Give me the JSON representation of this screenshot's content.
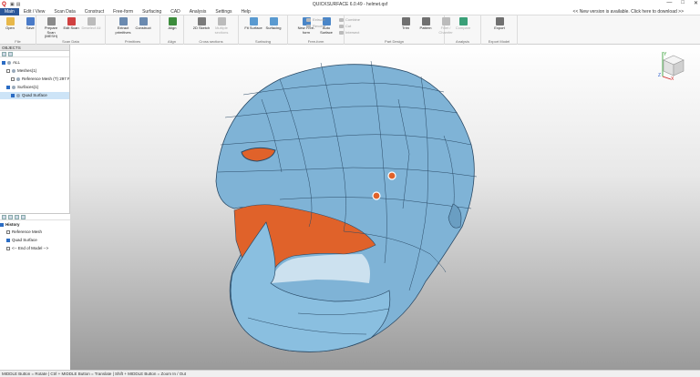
{
  "app": {
    "title": "QUICKSURFACE 6.0.49 - helmet.qsf",
    "notice": "<< New version is available. Click here to download >>",
    "window_controls": [
      "—",
      "□",
      "✕"
    ]
  },
  "menu": {
    "tabs": [
      "Main",
      "Edit / View",
      "Scan Data",
      "Construct",
      "Free-form",
      "Surfacing",
      "CAD",
      "Analysis",
      "Settings",
      "Help"
    ],
    "active_index": 0
  },
  "ribbon": {
    "groups": [
      {
        "label": "File",
        "buttons": [
          {
            "label": "Open",
            "icon": "folder-icon",
            "color": "#e8b84a"
          },
          {
            "label": "Save",
            "icon": "save-icon",
            "color": "#4a7bc8"
          }
        ]
      },
      {
        "label": "Scan Data",
        "buttons": [
          {
            "label": "Prepare Scan (MESH)",
            "icon": "mesh-icon",
            "color": "#8a8a8a"
          },
          {
            "label": "Edit Scan",
            "icon": "edit-scan-icon",
            "color": "#d04040"
          },
          {
            "label": "Deselect All",
            "icon": "deselect-icon",
            "color": "#bbbbbb",
            "dim": true
          }
        ]
      },
      {
        "label": "Primitives",
        "buttons": [
          {
            "label": "Extract primitives",
            "icon": "extract-icon",
            "color": "#6a8ab0"
          },
          {
            "label": "Construct",
            "icon": "construct-icon",
            "color": "#6a8ab0"
          }
        ]
      },
      {
        "label": "Align",
        "buttons": [
          {
            "label": "Align",
            "icon": "align-icon",
            "color": "#3c8c3c"
          }
        ]
      },
      {
        "label": "Cross sections",
        "buttons": [
          {
            "label": "2D Sketch",
            "icon": "sketch-icon",
            "color": "#7a7a7a"
          },
          {
            "label": "Multiple sections",
            "icon": "sections-icon",
            "color": "#bbbbbb",
            "dim": true
          }
        ]
      },
      {
        "label": "Surfacing",
        "buttons": [
          {
            "label": "Fit Surface",
            "icon": "fit-surface-icon",
            "color": "#5a9ad0"
          },
          {
            "label": "Surfacing",
            "icon": "surfacing-icon",
            "color": "#5a9ad0"
          }
        ]
      },
      {
        "label": "Free-form",
        "buttons": [
          {
            "label": "New Free-form",
            "icon": "new-freeform-icon",
            "color": "#4a86c8"
          },
          {
            "label": "Auto Surface",
            "icon": "auto-surface-icon",
            "color": "#4a86c8"
          }
        ]
      },
      {
        "label": "Part Design",
        "buttons": [
          {
            "label": "Trim",
            "icon": "trim-icon",
            "color": "#707070"
          },
          {
            "label": "Pattern",
            "icon": "pattern-icon",
            "color": "#707070"
          },
          {
            "label": "Fillet / Chamfer",
            "icon": "fillet-icon",
            "color": "#bbbbbb",
            "dim": true
          }
        ]
      },
      {
        "label": "Analysis",
        "buttons": [
          {
            "label": "Compare",
            "icon": "compare-icon",
            "color": "#3aa078",
            "dim": true
          }
        ]
      },
      {
        "label": "Export Model",
        "buttons": [
          {
            "label": "Export",
            "icon": "export-icon",
            "color": "#707070"
          }
        ]
      }
    ],
    "small_buttons": {
      "extrude": "Extrude",
      "revolve": "Revolve",
      "combine": "Combine",
      "cut": "Cut",
      "intersect": "Intersect"
    }
  },
  "objects": {
    "header": "OBJECTS",
    "tree": [
      {
        "label": "ALL",
        "indent": 0,
        "checked": true,
        "selected": false
      },
      {
        "label": "Meshes(1)",
        "indent": 1,
        "checked": false,
        "selected": false
      },
      {
        "label": "Reference Mesh (T) 297 R",
        "indent": 2,
        "checked": false,
        "selected": false
      },
      {
        "label": "Surfaces(1)",
        "indent": 1,
        "checked": true,
        "selected": false
      },
      {
        "label": "Quad Surface",
        "indent": 2,
        "checked": true,
        "selected": true
      }
    ]
  },
  "history": {
    "header": "History",
    "items": [
      {
        "label": "Reference Mesh",
        "checked": false
      },
      {
        "label": "Quad Surface",
        "checked": true
      },
      {
        "label": "<-- End of Model -->",
        "checked": false
      }
    ]
  },
  "viewport": {
    "model": "helmet",
    "surface_color": "#7fb3d6",
    "inner_color": "#e0622a",
    "axis_labels": {
      "y": "Y",
      "z": "Z",
      "x": "X"
    }
  },
  "status": {
    "text": "MIDDLE Button = Rotate | Ctrl + MIDDLE Button = Translate | Shift + MIDDLE Button = Zoom In / Out"
  }
}
